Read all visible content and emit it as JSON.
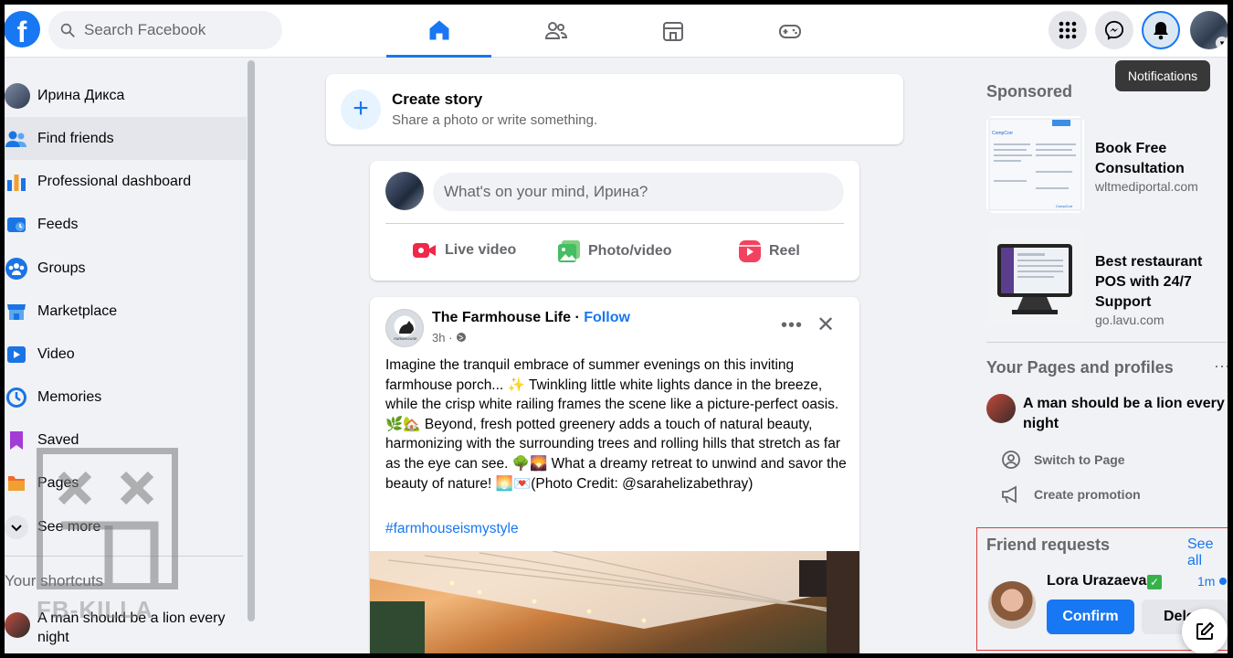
{
  "topbar": {
    "logo": "f",
    "search_placeholder": "Search Facebook",
    "tooltip": "Notifications"
  },
  "sidebar": {
    "profile_name": "Ирина Дикса",
    "items": [
      {
        "label": "Find friends",
        "icon": "friends-icon"
      },
      {
        "label": "Professional dashboard",
        "icon": "dashboard-icon"
      },
      {
        "label": "Feeds",
        "icon": "feeds-icon"
      },
      {
        "label": "Groups",
        "icon": "groups-icon"
      },
      {
        "label": "Marketplace",
        "icon": "marketplace-icon"
      },
      {
        "label": "Video",
        "icon": "video-icon"
      },
      {
        "label": "Memories",
        "icon": "memories-icon"
      },
      {
        "label": "Saved",
        "icon": "saved-icon"
      },
      {
        "label": "Pages",
        "icon": "pages-icon"
      },
      {
        "label": "See more",
        "icon": "chevron-down-icon"
      }
    ],
    "shortcuts_title": "Your shortcuts",
    "shortcut_name": "A man should be a lion every night"
  },
  "watermark": {
    "text": "FB-KILLA"
  },
  "feed": {
    "create_story": {
      "title": "Create story",
      "subtitle": "Share a photo or write something."
    },
    "composer": {
      "placeholder": "What's on your mind, Ирина?",
      "actions": {
        "live": "Live video",
        "photo": "Photo/video",
        "reel": "Reel"
      }
    },
    "post": {
      "page_name": "The Farmhouse Life",
      "separator": " · ",
      "follow": "Follow",
      "time": "3h ·",
      "text": "Imagine the tranquil embrace of summer evenings on this inviting farmhouse porch... ✨ Twinkling little white lights dance in the breeze, while the crisp white railing frames the scene like a picture-perfect oasis. 🌿🏡 Beyond, fresh potted greenery adds a touch of natural beauty, harmonizing with the surrounding trees and rolling hills that stretch as far as the eye can see. 🌳🌄 What a dreamy retreat to unwind and savor the beauty of nature! 🌅💌(Photo Credit: @sarahelizabethray)",
      "hashtag": "#farmhouseismystyle"
    }
  },
  "rightbar": {
    "sponsored_title": "Sponsored",
    "ads": [
      {
        "title": "Book Free Consultation",
        "site": "wltmediportal.com"
      },
      {
        "title": "Best restaurant POS with 24/7 Support",
        "site": "go.lavu.com"
      }
    ],
    "pages_title": "Your Pages and profiles",
    "pages_more": "···",
    "page_name": "A man should be a lion every night",
    "switch_label": "Switch to Page",
    "promo_label": "Create promotion",
    "friend_requests": {
      "title": "Friend requests",
      "see_all": "See all",
      "name": "Lora Urazaeva",
      "time": "1m",
      "confirm": "Confirm",
      "delete": "Delete"
    }
  },
  "colors": {
    "accent": "#1877f2",
    "background": "#f0f2f5"
  }
}
